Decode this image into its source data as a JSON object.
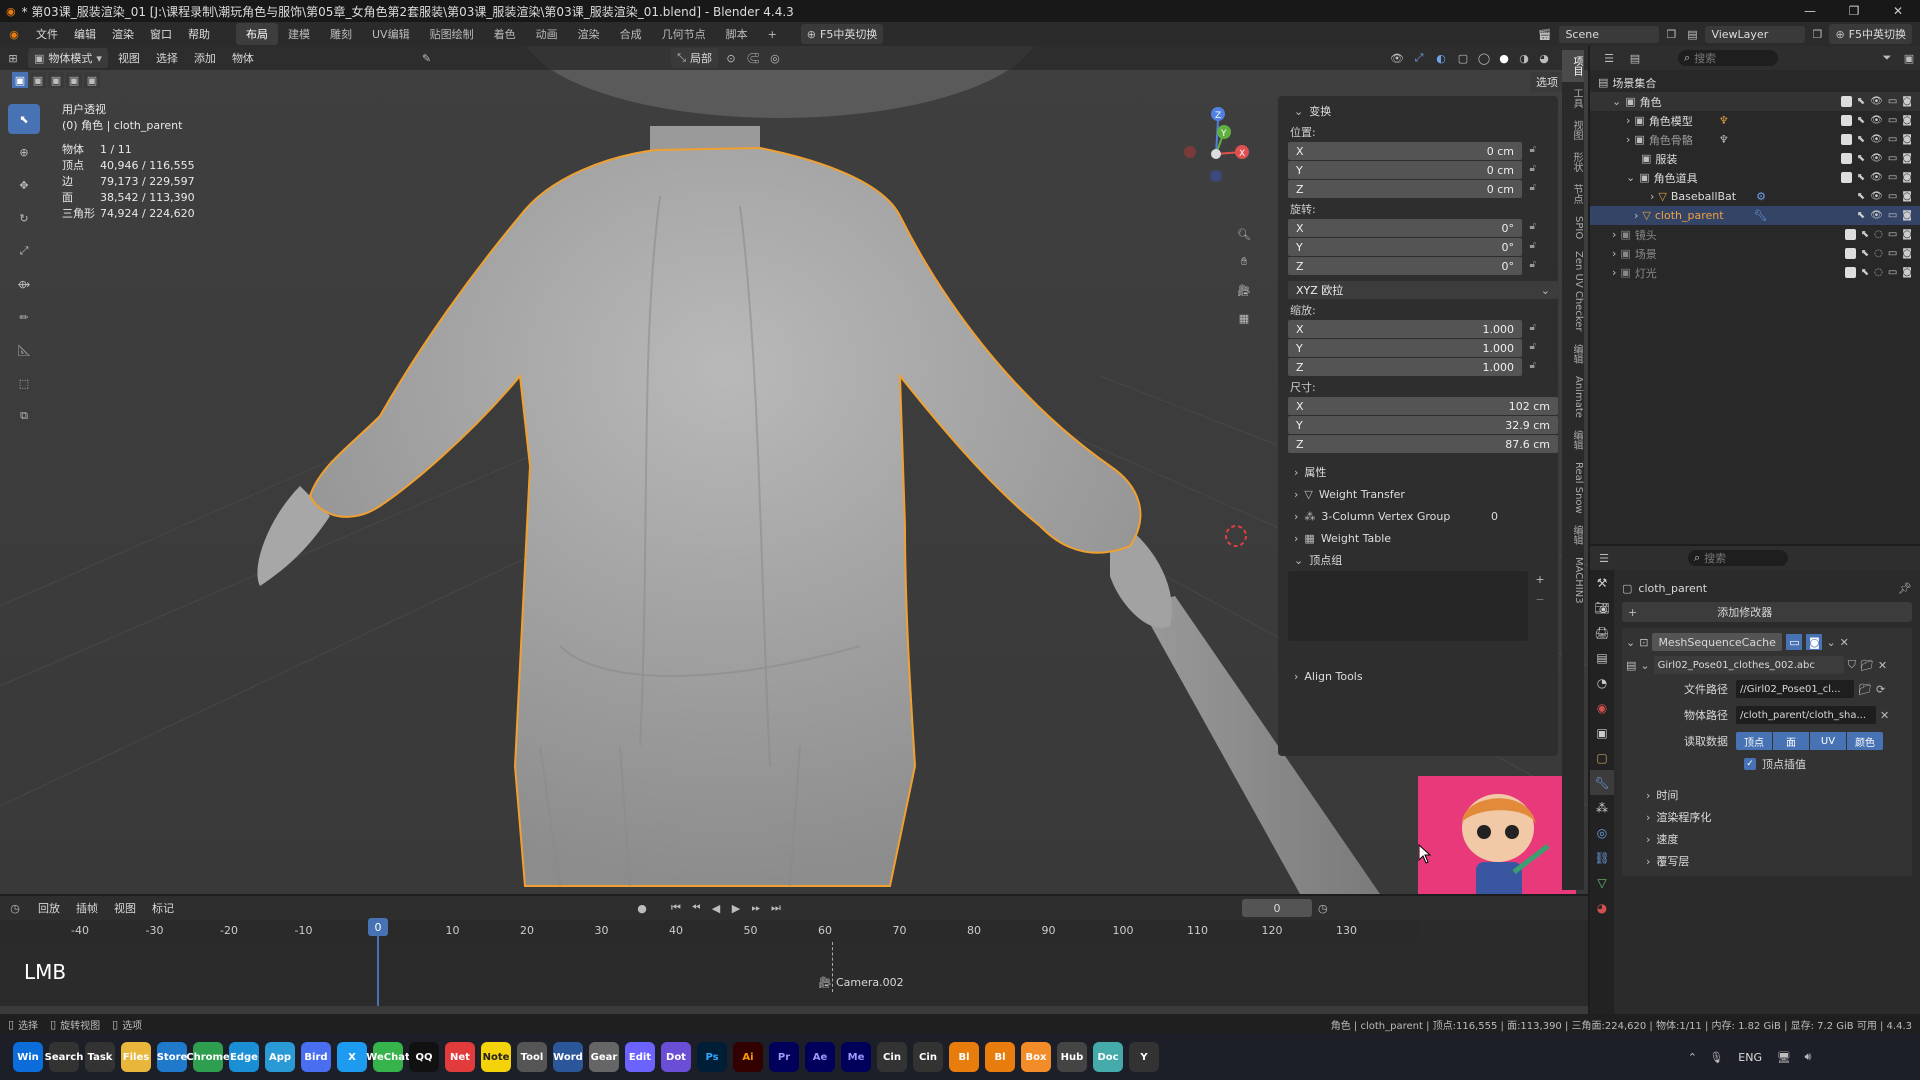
{
  "window": {
    "title": "* 第03课_服装渲染_01 [J:\\课程录制\\潮玩角色与服饰\\第05章_女角色第2套服装\\第03课_服装渲染\\第03课_服装渲染_01.blend] - Blender 4.4.3"
  },
  "menubar": {
    "menus": [
      "文件",
      "编辑",
      "渲染",
      "窗口",
      "帮助"
    ],
    "workspaces": [
      "布局",
      "建模",
      "雕刻",
      "UV编辑",
      "贴图绘制",
      "着色",
      "动画",
      "渲染",
      "合成",
      "几何节点",
      "脚本"
    ],
    "active_workspace": "布局",
    "add_tab": "+",
    "switch_label": "F5中英切换",
    "scene_label": "Scene",
    "viewlayer_label": "ViewLayer",
    "switch_label_right": "F5中英切换"
  },
  "viewport": {
    "mode_label": "物体模式",
    "menus": [
      "视图",
      "选择",
      "添加",
      "物体"
    ],
    "transform_orient": "局部",
    "options_label": "选项",
    "view_name": "用户透视",
    "object_path": "(0) 角色 | cloth_parent",
    "stats": [
      {
        "k": "物体",
        "v": "1 / 11"
      },
      {
        "k": "顶点",
        "v": "40,946 / 116,555"
      },
      {
        "k": "边",
        "v": "79,173 / 229,597"
      },
      {
        "k": "面",
        "v": "38,542 / 113,390"
      },
      {
        "k": "三角形",
        "v": "74,924 / 224,620"
      }
    ],
    "gizmo": {
      "x": "X",
      "y": "Y",
      "z": "Z"
    }
  },
  "npanel": {
    "transform_title": "变换",
    "location_label": "位置:",
    "location": [
      {
        "axis": "X",
        "value": "0 cm"
      },
      {
        "axis": "Y",
        "value": "0 cm"
      },
      {
        "axis": "Z",
        "value": "0 cm"
      }
    ],
    "rotation_label": "旋转:",
    "rotation": [
      {
        "axis": "X",
        "value": "0°"
      },
      {
        "axis": "Y",
        "value": "0°"
      },
      {
        "axis": "Z",
        "value": "0°"
      }
    ],
    "rotation_mode": "XYZ 欧拉",
    "scale_label": "缩放:",
    "scale": [
      {
        "axis": "X",
        "value": "1.000"
      },
      {
        "axis": "Y",
        "value": "1.000"
      },
      {
        "axis": "Z",
        "value": "1.000"
      }
    ],
    "dimensions_label": "尺寸:",
    "dimensions": [
      {
        "axis": "X",
        "value": "102 cm"
      },
      {
        "axis": "Y",
        "value": "32.9 cm"
      },
      {
        "axis": "Z",
        "value": "87.6 cm"
      }
    ],
    "properties_title": "属性",
    "weight_transfer": "Weight Transfer",
    "vertex_group_3col": "3-Column Vertex Group",
    "vertex_group_3col_value": "0",
    "weight_table": "Weight Table",
    "vertex_groups_title": "顶点组",
    "align_tools": "Align Tools",
    "tabs": [
      "项目",
      "工具",
      "视图",
      "形状",
      "节点",
      "SPIO",
      "Zen UV Checker",
      "编辑",
      "Animate",
      "编辑",
      "Real Snow",
      "编辑",
      "MACHIN3"
    ]
  },
  "outliner": {
    "search_placeholder": "搜索",
    "items": [
      {
        "name": "场景集合",
        "depth": 0,
        "type": "scene"
      },
      {
        "name": "角色",
        "depth": 1,
        "type": "collection",
        "checked": true
      },
      {
        "name": "角色模型",
        "depth": 2,
        "type": "collection",
        "checked": true
      },
      {
        "name": "角色骨骼",
        "depth": 2,
        "type": "collection",
        "checked": true,
        "dim": true
      },
      {
        "name": "服装",
        "depth": 2,
        "type": "collection",
        "checked": true
      },
      {
        "name": "角色道具",
        "depth": 2,
        "type": "collection",
        "checked": true
      },
      {
        "name": "BaseballBat",
        "depth": 3,
        "type": "mesh"
      },
      {
        "name": "cloth_parent",
        "depth": 3,
        "type": "mesh",
        "active": true
      },
      {
        "name": "镜头",
        "depth": 1,
        "type": "collection",
        "checked": true,
        "dim": true
      },
      {
        "name": "场景",
        "depth": 1,
        "type": "collection",
        "checked": true,
        "dim": true
      },
      {
        "name": "灯光",
        "depth": 1,
        "type": "collection",
        "checked": true,
        "dim": true
      }
    ]
  },
  "properties": {
    "search_placeholder": "搜索",
    "object_name": "cloth_parent",
    "add_modifier": "添加修改器",
    "modifier_name": "MeshSequenceCache",
    "cache_file": "Girl02_Pose01_clothes_002.abc",
    "file_path_label": "文件路径",
    "file_path": "//Girl02_Pose01_cl...",
    "object_path_label": "物体路径",
    "object_path": "/cloth_parent/cloth_sha...",
    "read_data_label": "读取数据",
    "read_data": [
      "顶点",
      "面",
      "UV",
      "颜色"
    ],
    "vertex_interp_label": "顶点插值",
    "subpanels": [
      "时间",
      "渲染程序化",
      "速度",
      "覆写层"
    ]
  },
  "timeline": {
    "menus": [
      "回放",
      "插帧",
      "视图",
      "标记"
    ],
    "current_frame": "0",
    "ruler_ticks": [
      "-40",
      "-30",
      "-20",
      "-10",
      "0",
      "10",
      "20",
      "30",
      "40",
      "50",
      "60",
      "70",
      "80",
      "90",
      "100",
      "110",
      "120",
      "130"
    ],
    "camera_marker": "Camera.002",
    "mouse_hint": "LMB"
  },
  "statusbar": {
    "items": [
      "选择",
      "旋转视图",
      "选项"
    ],
    "info": "角色 | cloth_parent | 顶点:116,555 | 面:113,390 | 三角面:224,620 | 物体:1/11 | 内存: 1.82 GiB | 显存: 7.2 GiB 可用 | 4.4.3"
  },
  "taskbar": {
    "apps": [
      "Win",
      "Search",
      "Task",
      "Files",
      "Store",
      "Chrome",
      "Edge",
      "App",
      "Bird",
      "X",
      "WeChat",
      "QQ",
      "Net",
      "Note",
      "Tool",
      "Word",
      "Gear",
      "Edit",
      "Dot",
      "Ps",
      "Ai",
      "Pr",
      "Ae",
      "Me",
      "Cin",
      "Cin",
      "Bl",
      "Bl",
      "Box",
      "Hub",
      "Doc",
      "Y"
    ],
    "ime": "ENG"
  },
  "colors": {
    "accent": "#4772b3",
    "selection_outline": "#f0a030",
    "active_text": "#f0a040"
  }
}
